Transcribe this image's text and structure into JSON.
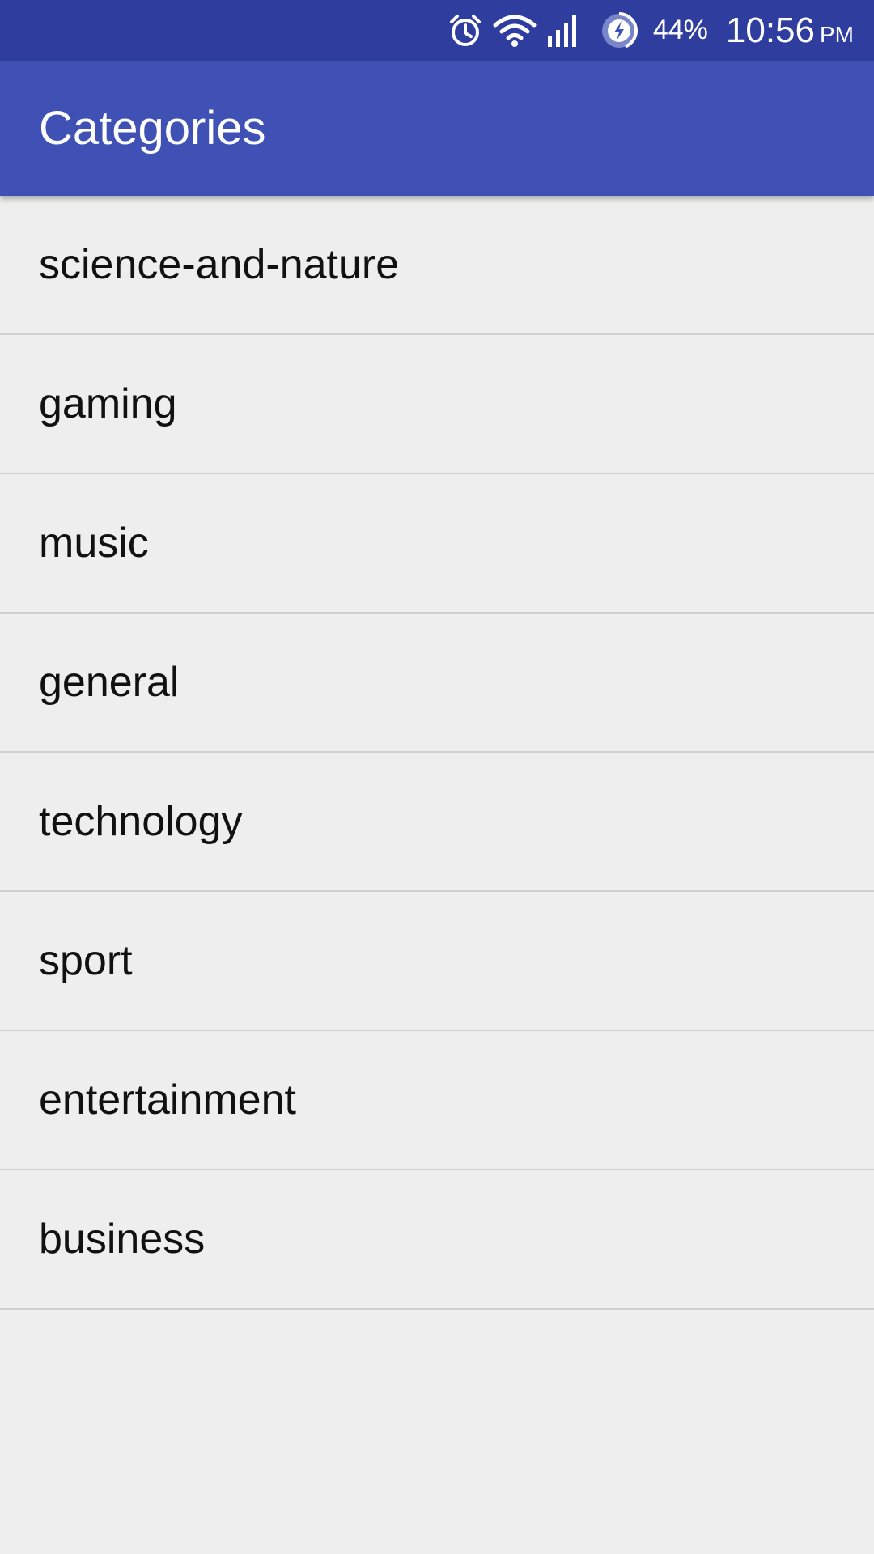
{
  "status_bar": {
    "icons": [
      "alarm-icon",
      "wifi-icon",
      "cell-signal-icon",
      "battery-charging-icon"
    ],
    "battery_percent": "44%",
    "time": "10:56",
    "ampm": "PM",
    "color": "#2f3d9e"
  },
  "app_bar": {
    "title": "Categories",
    "color": "#3f51b5"
  },
  "categories": [
    {
      "label": "science-and-nature"
    },
    {
      "label": "gaming"
    },
    {
      "label": "music"
    },
    {
      "label": "general"
    },
    {
      "label": "technology"
    },
    {
      "label": "sport"
    },
    {
      "label": "entertainment"
    },
    {
      "label": "business"
    }
  ]
}
